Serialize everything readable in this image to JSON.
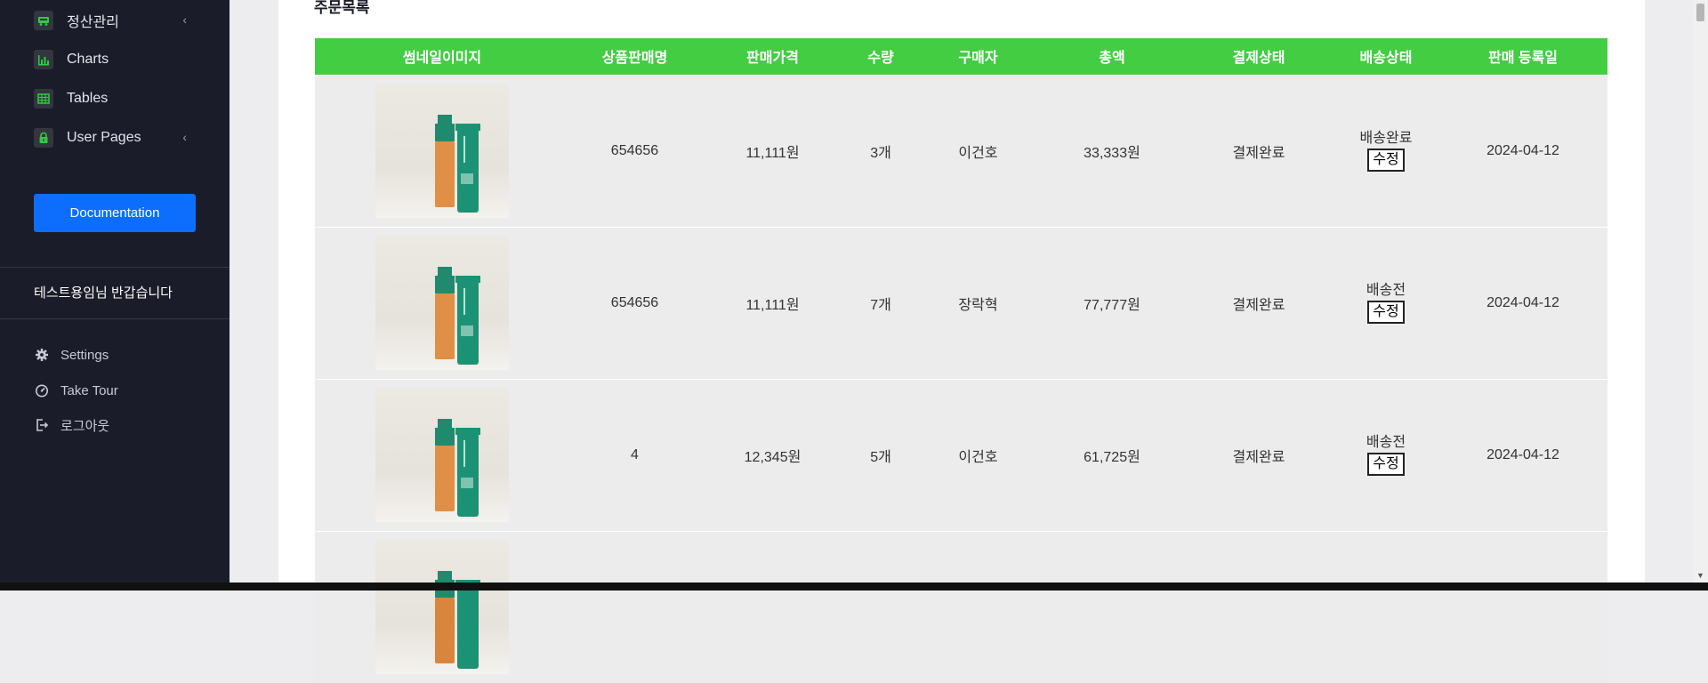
{
  "sidebar": {
    "nav": [
      {
        "label": "정산관리",
        "icon": "truck-icon",
        "has_chevron": true
      },
      {
        "label": "Charts",
        "icon": "bar-chart-icon",
        "has_chevron": false
      },
      {
        "label": "Tables",
        "icon": "table-icon",
        "has_chevron": false
      },
      {
        "label": "User Pages",
        "icon": "lock-icon",
        "has_chevron": true
      }
    ],
    "chevron": "‹",
    "documentation_label": "Documentation",
    "greeting": "테스트용임님 반갑습니다",
    "bottom": [
      {
        "label": "Settings",
        "icon": "gear-icon"
      },
      {
        "label": "Take Tour",
        "icon": "gauge-icon"
      },
      {
        "label": "로그아웃",
        "icon": "logout-icon"
      }
    ]
  },
  "main": {
    "section_title": "주문목록",
    "columns": [
      "썸네일이미지",
      "상품판매명",
      "판매가격",
      "수량",
      "구매자",
      "총액",
      "결제상태",
      "배송상태",
      "판매 등록일"
    ],
    "rows": [
      {
        "product_name": "654656",
        "price": "11,111원",
        "quantity": "3개",
        "buyer": "이건호",
        "total": "33,333원",
        "payment_status": "결제완료",
        "shipping_status": "배송완료",
        "edit_label": "수정",
        "date": "2024-04-12"
      },
      {
        "product_name": "654656",
        "price": "11,111원",
        "quantity": "7개",
        "buyer": "장락혁",
        "total": "77,777원",
        "payment_status": "결제완료",
        "shipping_status": "배송전",
        "edit_label": "수정",
        "date": "2024-04-12"
      },
      {
        "product_name": "4",
        "price": "12,345원",
        "quantity": "5개",
        "buyer": "이건호",
        "total": "61,725원",
        "payment_status": "결제완료",
        "shipping_status": "배송전",
        "edit_label": "수정",
        "date": "2024-04-12"
      },
      {
        "product_name": "",
        "price": "",
        "quantity": "",
        "buyer": "",
        "total": "",
        "payment_status": "",
        "shipping_status": "",
        "edit_label": "",
        "date": ""
      }
    ]
  },
  "colors": {
    "sidebar_bg": "#1b1c29",
    "header_green": "#43cd43",
    "icon_green": "#2ecc40",
    "primary_blue": "#0d6efd",
    "row_bg": "#ececec",
    "page_bg": "#ededf0"
  },
  "scrollbar": {
    "up_arrow": "▲",
    "down_arrow": "▼"
  }
}
